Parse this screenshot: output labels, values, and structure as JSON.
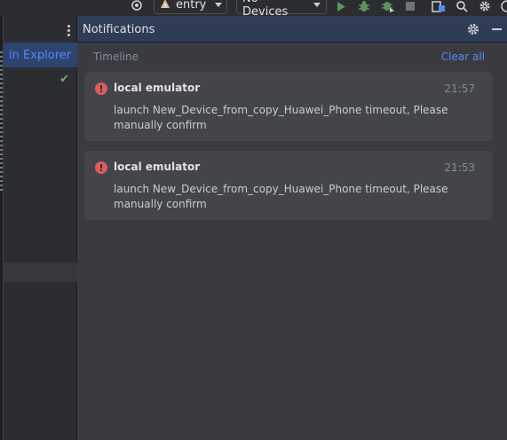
{
  "toolbar": {
    "module_combo": {
      "label": "entry"
    },
    "device_combo": {
      "label": "No Devices"
    },
    "icons": [
      "target-icon",
      "module-icon",
      "run-icon",
      "debug-icon",
      "attach-debugger-icon",
      "stop-icon",
      "device-manager-icon",
      "search-icon",
      "settings-icon"
    ],
    "colors": {
      "run": "#57965c",
      "debug": "#57965c",
      "stop": "#6f737a"
    }
  },
  "left_panel": {
    "selected_item": "in Explorer",
    "status_icon": "check-icon",
    "status_color": "#5fb865"
  },
  "notifications": {
    "title": "Notifications",
    "section_label": "Timeline",
    "clear_all_label": "Clear all",
    "items": [
      {
        "source": "local emulator",
        "time": "21:57",
        "message": "launch New_Device_from_copy_Huawei_Phone timeout, Please manually confirm",
        "severity": "error"
      },
      {
        "source": "local emulator",
        "time": "21:53",
        "message": "launch New_Device_from_copy_Huawei_Phone timeout, Please manually confirm",
        "severity": "error"
      }
    ]
  },
  "colors": {
    "background": "#2b2d30",
    "panel": "#393b40",
    "card": "#43454a",
    "header": "#2f3c55",
    "accent_link": "#548af7",
    "error": "#db5c5c"
  }
}
